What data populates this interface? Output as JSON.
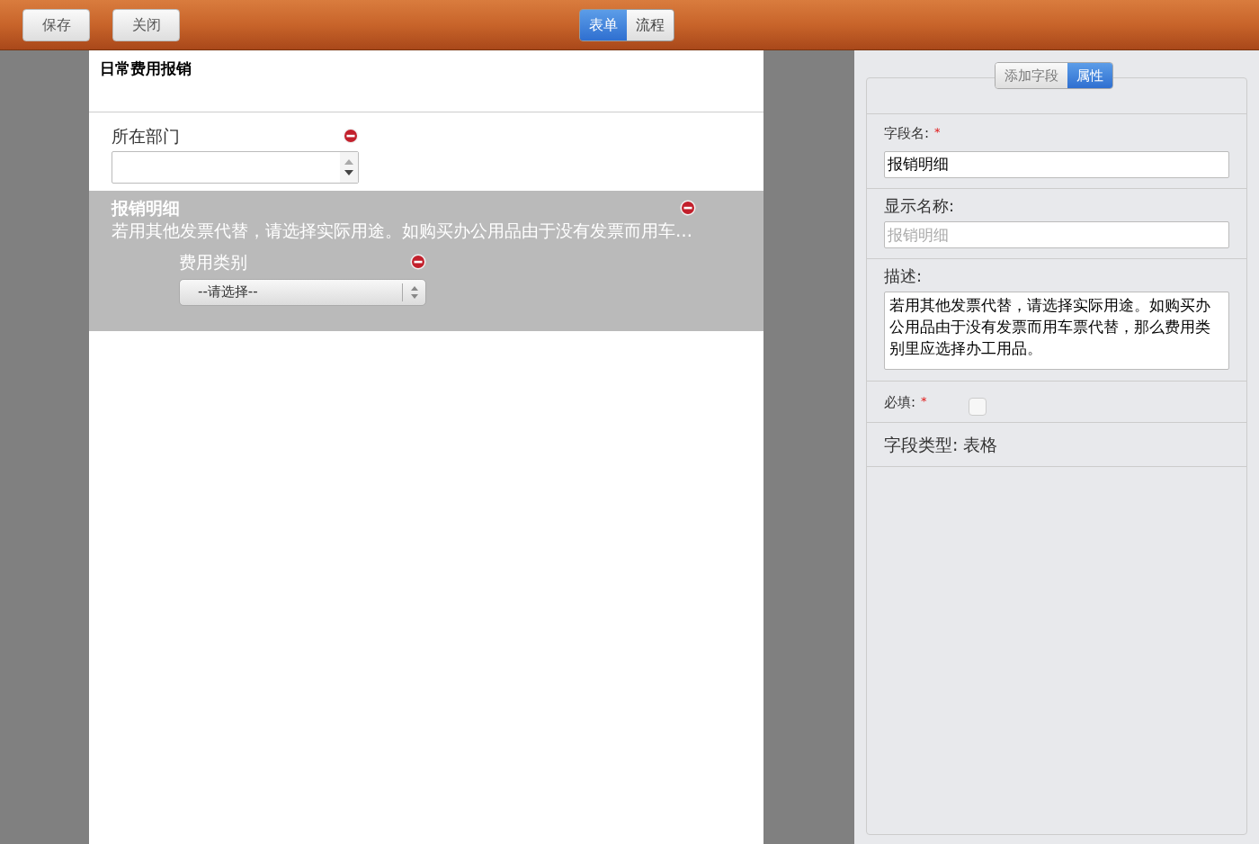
{
  "toolbar": {
    "buttons": [
      {
        "label": "保存"
      },
      {
        "label": "关闭"
      }
    ],
    "view_tabs": [
      {
        "label": "表单",
        "selected": true
      },
      {
        "label": "流程",
        "selected": false
      }
    ]
  },
  "form": {
    "title": "日常费用报销",
    "fields": [
      {
        "kind": "number",
        "label": "所在部门",
        "selected": false
      },
      {
        "kind": "table",
        "label": "报销明细",
        "description": "若用其他发票代替，请选择实际用途。如购买办公用品由于没有发票而用车…",
        "selected": true,
        "children": [
          {
            "kind": "select",
            "label": "费用类别",
            "value": "--请选择--",
            "selected": false
          }
        ]
      }
    ]
  },
  "properties": {
    "tabs": [
      {
        "label": "添加字段",
        "selected": false
      },
      {
        "label": "属性",
        "selected": true
      }
    ],
    "field_name": {
      "label": "字段名:",
      "required_mark": "*",
      "value": "报销明细"
    },
    "display_name": {
      "label": "显示名称:",
      "placeholder": "报销明细"
    },
    "description": {
      "label": "描述:",
      "value": "若用其他发票代替，请选择实际用途。如购买办公用品由于没有发票而用车票代替，那么费用类别里应选择办工用品。"
    },
    "required": {
      "label": "必填:",
      "required_mark": "*",
      "checked": false
    },
    "field_type": "字段类型: 表格"
  }
}
